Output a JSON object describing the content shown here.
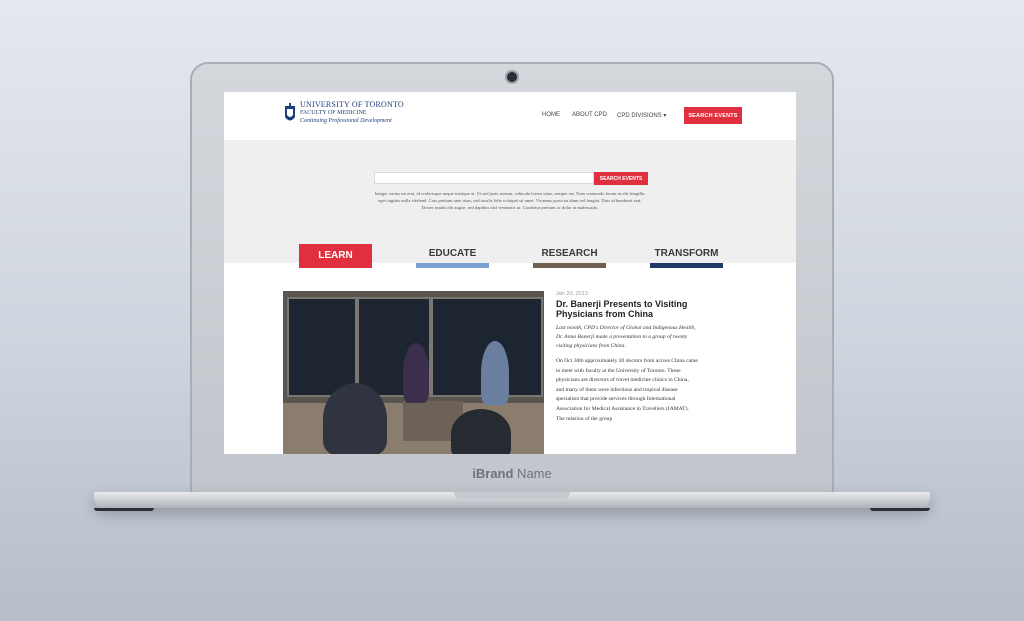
{
  "site": {
    "logo": {
      "line1": "UNIVERSITY OF TORONTO",
      "line2": "FACULTY OF MEDICINE",
      "line3": "Continuing Professional Development"
    },
    "nav": {
      "home": "HOME",
      "about": "ABOUT CPD",
      "divisions": "CPD DIVISIONS ▾"
    },
    "header_search_label": "SEARCH EVENTS"
  },
  "hero": {
    "search_button": "SEARCH EVENTS",
    "search_placeholder": "",
    "intro": "Integer varius mi erat, id scelerisque neque tristique at. Ut sed justo rutrum, vehicula lorem vitae, semper est. Nam commodo lorem ut elit fringilla, eget sagittis nulla eleifend. Cras pretium ante risus, sed iaculis felis volutpat sit amet. Vivamus porta eu diam vel feugiat. Duis id hendrerit erat. Donec mattis elit augue, sed dapibus nisl venenatis ut. Curabitur pretium ac dolor ut malesuada."
  },
  "tabs": {
    "learn": "LEARN",
    "educate": "EDUCATE",
    "research": "RESEARCH",
    "transform": "TRANSFORM"
  },
  "colors": {
    "accent_red": "#e0303f",
    "educate_bar": "#7aa1d2",
    "research_bar": "#6e5e4e",
    "transform_bar": "#1f3a66"
  },
  "article": {
    "date": "Jan 20, 2013",
    "title": "Dr. Banerji Presents to Visiting Physicians from China",
    "lead": "Last month, CPD's Director of Global and Indigenous Health, Dr. Anna Banerji made a presentation to a group of twenty visiting physicians from China.",
    "body": "On Oct 30th approximately 20 doctors from across China came to meet with faculty at the University of Toronto. These physicians are directors of travel medicine clinics in China, and many of them were infectious and tropical disease specialists that provide services through International Association for Medical Assistance to Travellers (IAMAT). The mission of the group"
  },
  "device": {
    "brand_strong": "iBrand",
    "brand_rest": " Name"
  }
}
